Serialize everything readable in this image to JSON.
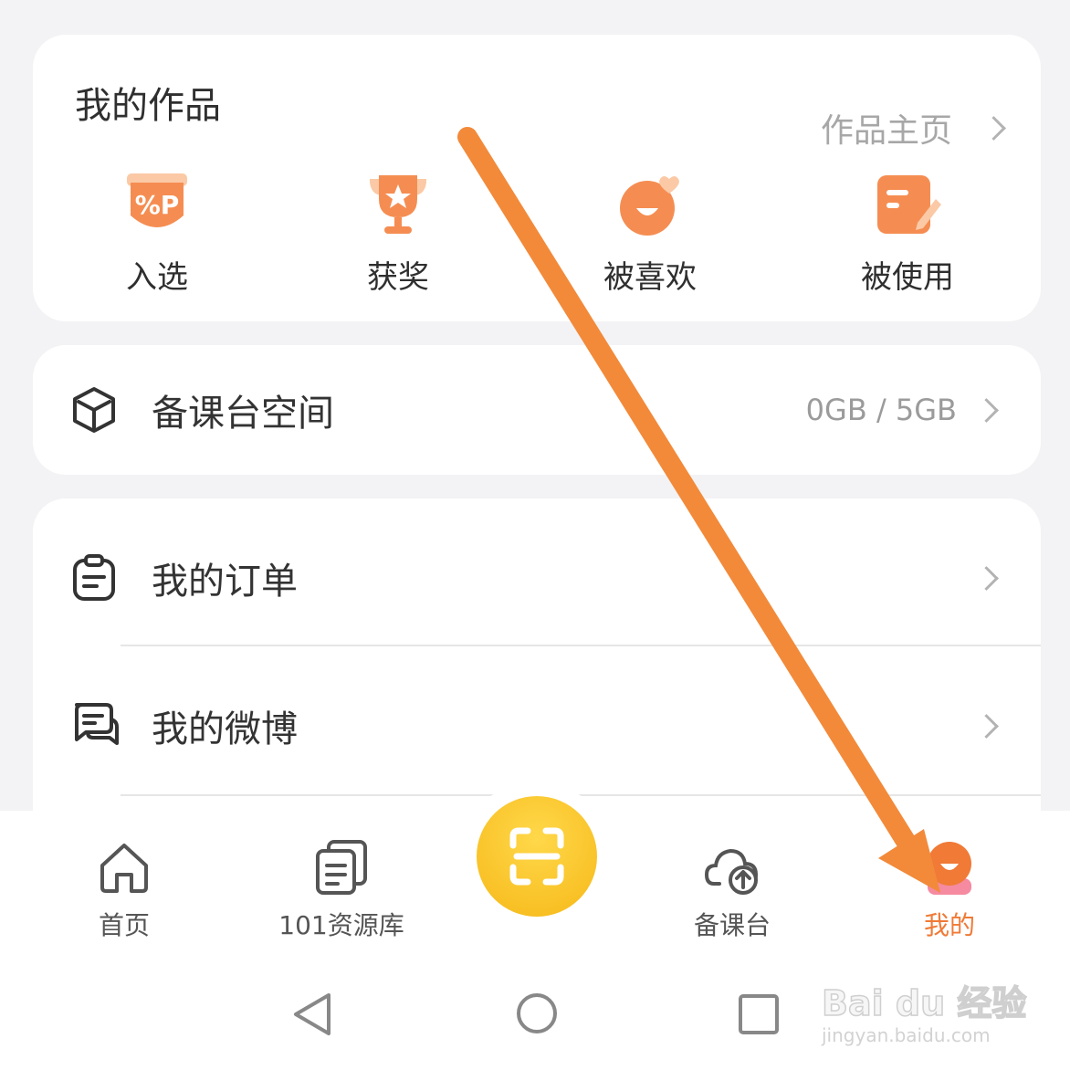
{
  "works": {
    "title": "我的作品",
    "home_link": "作品主页",
    "stats": [
      {
        "label": "入选",
        "icon": "selected-badge-icon"
      },
      {
        "label": "获奖",
        "icon": "trophy-icon"
      },
      {
        "label": "被喜欢",
        "icon": "liked-face-icon"
      },
      {
        "label": "被使用",
        "icon": "used-note-icon"
      }
    ]
  },
  "storage": {
    "label": "备课台空间",
    "value": "0GB / 5GB",
    "icon": "cube-icon"
  },
  "menu": [
    {
      "label": "我的订单",
      "icon": "clipboard-icon"
    },
    {
      "label": "我的微博",
      "icon": "chat-bubbles-icon"
    }
  ],
  "tabbar": {
    "tabs": [
      {
        "label": "首页",
        "icon": "home-icon"
      },
      {
        "label": "101资源库",
        "icon": "library-icon"
      },
      {
        "label": "备课台",
        "icon": "cloud-upload-icon"
      },
      {
        "label": "我的",
        "icon": "profile-icon",
        "active": true
      }
    ],
    "center_icon": "scan-icon"
  },
  "watermark": {
    "brand": "Bai du 经验",
    "url": "jingyan.baidu.com"
  },
  "colors": {
    "accent": "#f07a36",
    "arrow": "#f28a3a",
    "scan_yellow": "#f8c21f"
  }
}
